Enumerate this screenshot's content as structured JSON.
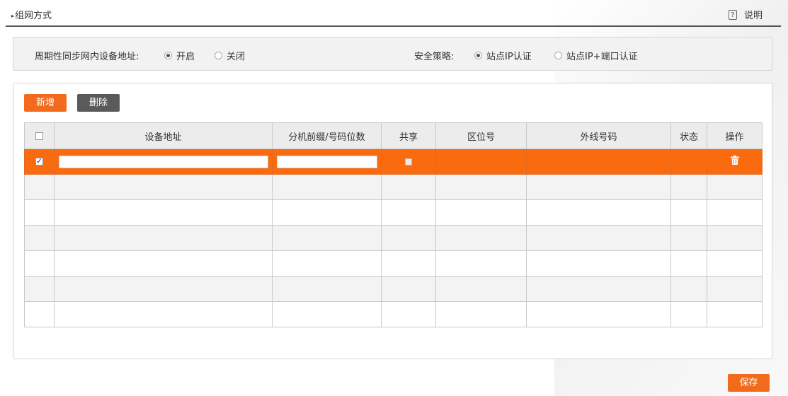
{
  "header": {
    "title": "组网方式",
    "help_label": "说明"
  },
  "settings": {
    "sync_label": "周期性同步网内设备地址:",
    "sync_on": "开启",
    "sync_off": "关闭",
    "sync_selected": "on",
    "policy_label": "安全策略:",
    "policy_ip": "站点IP认证",
    "policy_ip_port": "站点IP+端口认证",
    "policy_selected": "ip"
  },
  "toolbar": {
    "add_label": "新增",
    "delete_label": "删除"
  },
  "table": {
    "columns": [
      "设备地址",
      "分机前缀/号码位数",
      "共享",
      "区位号",
      "外线号码",
      "状态",
      "操作"
    ],
    "rows": [
      {
        "selected": true,
        "device_address": "",
        "prefix_digits": "",
        "shared": false,
        "area_code": "",
        "outside_number": "",
        "status": ""
      }
    ]
  },
  "footer": {
    "save_label": "保存"
  },
  "colors": {
    "accent": "#f26b1d",
    "selected_row": "#fa6b0f",
    "dark_button": "#5a5a5a"
  }
}
